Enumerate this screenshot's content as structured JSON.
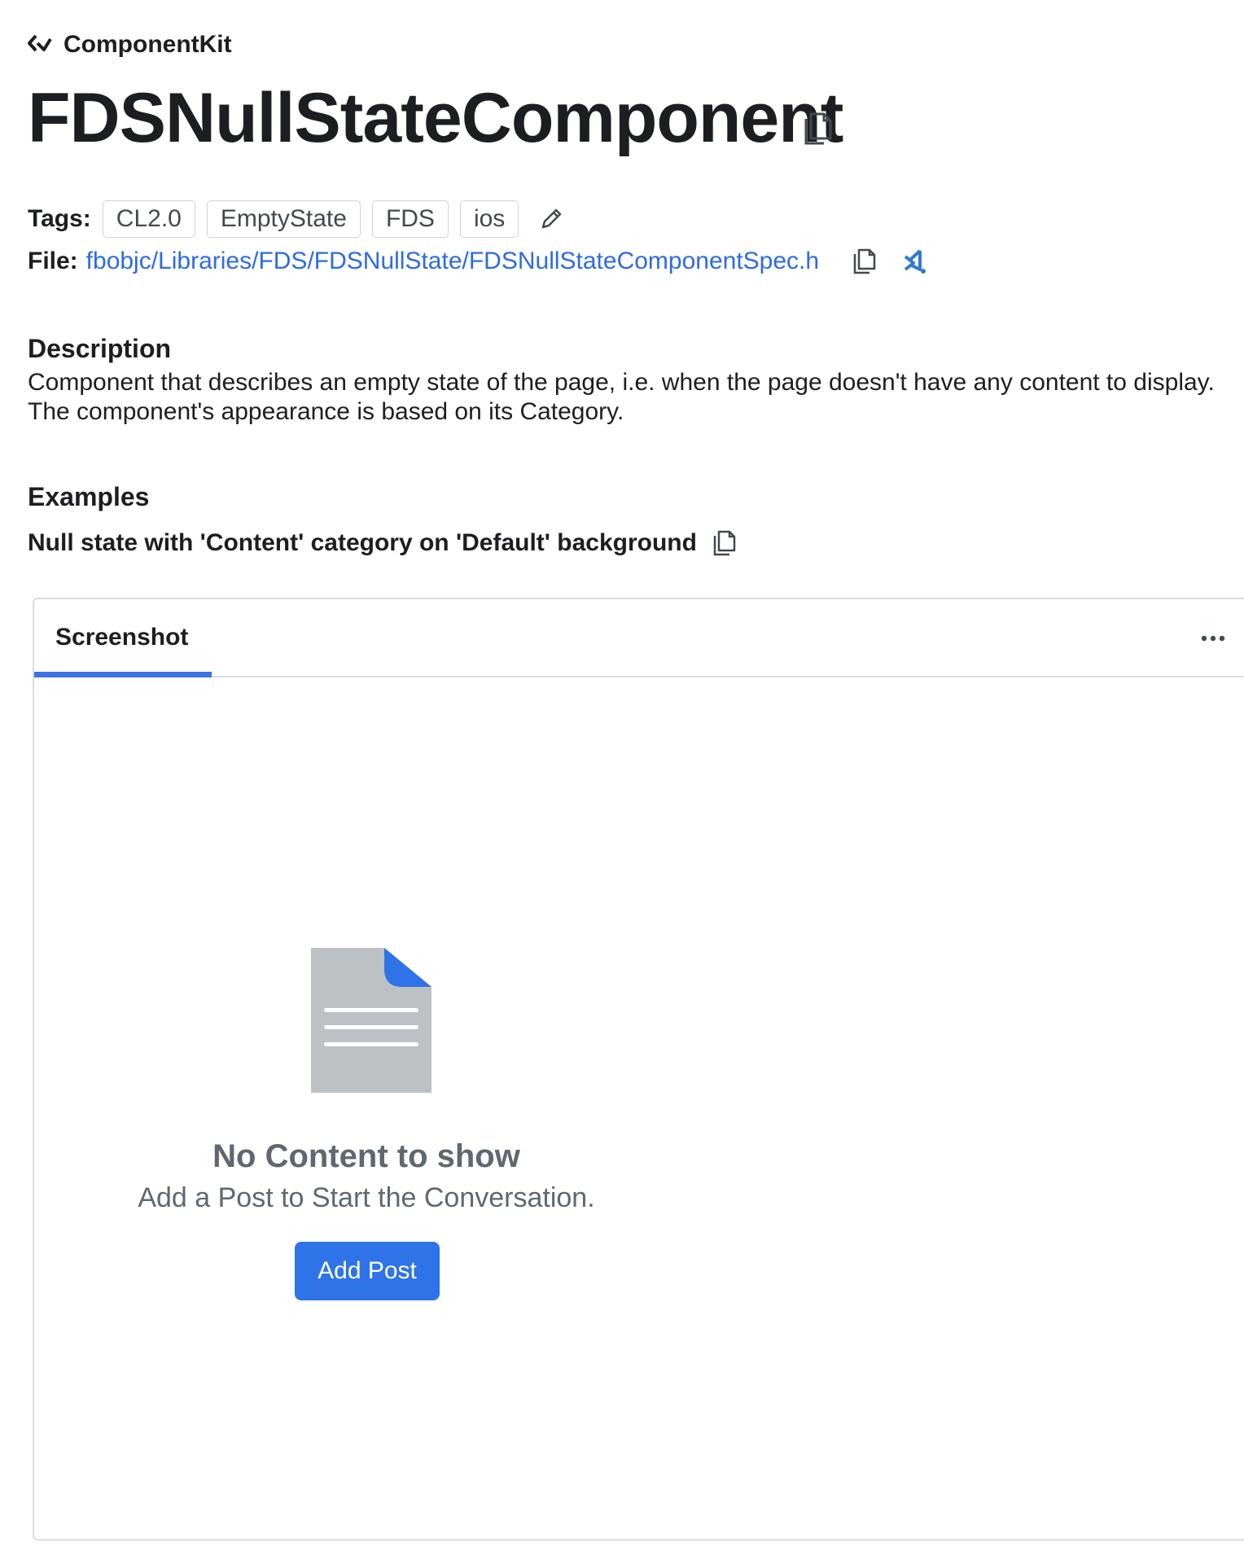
{
  "brand": {
    "name": "ComponentKit",
    "icon": "componentkit-logo-icon"
  },
  "page": {
    "title": "FDSNullStateComponent"
  },
  "tags": {
    "label": "Tags:",
    "items": [
      "CL2.0",
      "EmptyState",
      "FDS",
      "ios"
    ],
    "edit_icon": "pencil-icon"
  },
  "file": {
    "label": "File:",
    "path": "fbobjc/Libraries/FDS/FDSNullState/FDSNullStateComponentSpec.h",
    "copy_icon": "copy-icon",
    "editor_icon": "vscode-icon"
  },
  "description": {
    "heading": "Description",
    "text": "Component that describes an empty state of the page, i.e. when the page doesn't have any content to display. The component's appearance is based on its Category."
  },
  "examples": {
    "heading": "Examples",
    "example_title": "Null state with 'Content' category on 'Default' background"
  },
  "panel": {
    "tab_label": "Screenshot",
    "more_icon": "more-horizontal-icon"
  },
  "null_state": {
    "title": "No Content to show",
    "subtitle": "Add a Post to Start the Conversation.",
    "button_label": "Add Post",
    "illustration": "document-icon"
  },
  "colors": {
    "link": "#2d6be5",
    "accent": "#3b73e6",
    "button": "#2e73e8",
    "muted_text": "#606770",
    "doc_gray": "#bec1c4"
  }
}
